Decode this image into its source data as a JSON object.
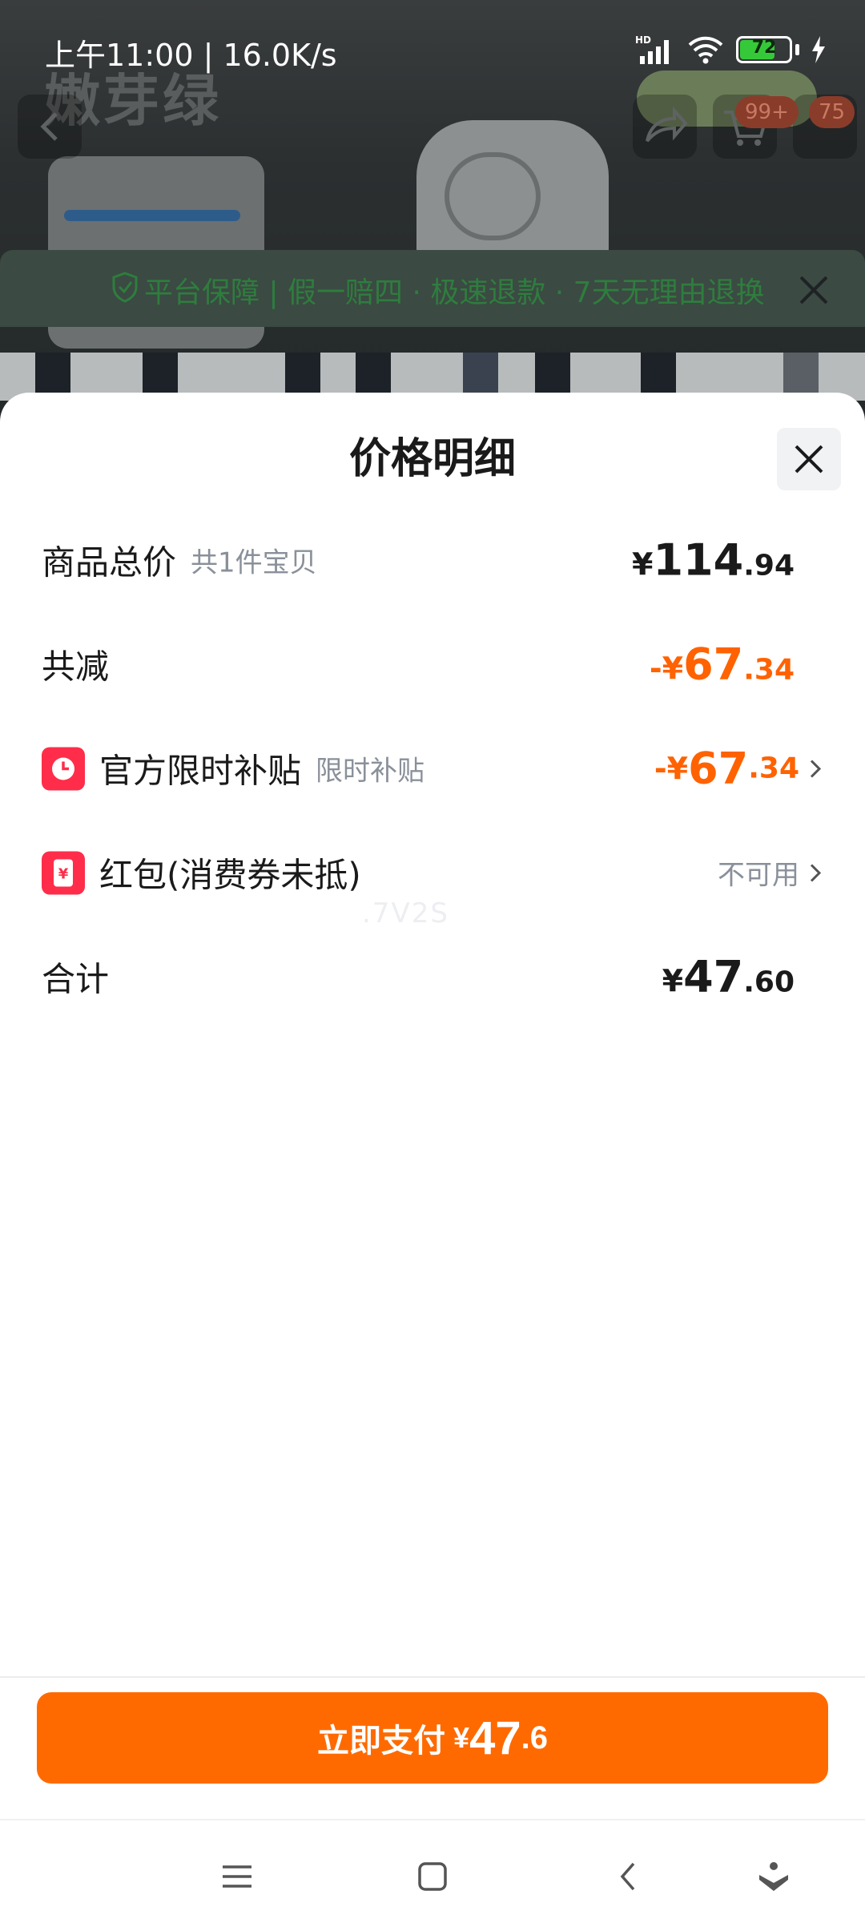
{
  "status_bar": {
    "time_speed": "上午11:00 | 16.0K/s",
    "network_label": "HD",
    "battery_level": "72",
    "battery_fraction": 0.72
  },
  "background": {
    "title": "嫩芽绿",
    "guarantee_text": "平台保障 | 假一赔四 · 极速退款 · 7天无理由退换",
    "badge_cart": "99+",
    "badge_more": "75"
  },
  "sheet": {
    "title": "价格明细",
    "rows": [
      {
        "label": "商品总价",
        "sub": "共1件宝贝",
        "sym": "¥",
        "int": "114",
        "dec": ".94"
      },
      {
        "label": "共减",
        "sub": "",
        "sym": "-¥",
        "int": "67",
        "dec": ".34"
      },
      {
        "label": "官方限时补贴",
        "sub": "限时补贴",
        "sym": "-¥",
        "int": "67",
        "dec": ".34"
      },
      {
        "label": "红包(消费券未抵)",
        "sub": "",
        "value_text": "不可用"
      },
      {
        "label": "合计",
        "sub": "",
        "sym": "¥",
        "int": "47",
        "dec": ".60"
      }
    ],
    "watermark": ".7V2S"
  },
  "pay": {
    "label": "立即支付",
    "sym": "¥",
    "int": "47",
    "dec": ".6"
  },
  "colors": {
    "accent": "#ff6a00",
    "discount": "#ff6200",
    "icon_red": "#ff2d4a"
  },
  "icons": {
    "close": "close-icon",
    "clock": "clock-icon",
    "coupon": "red-packet-icon",
    "chevron": "chevron-right-icon"
  }
}
